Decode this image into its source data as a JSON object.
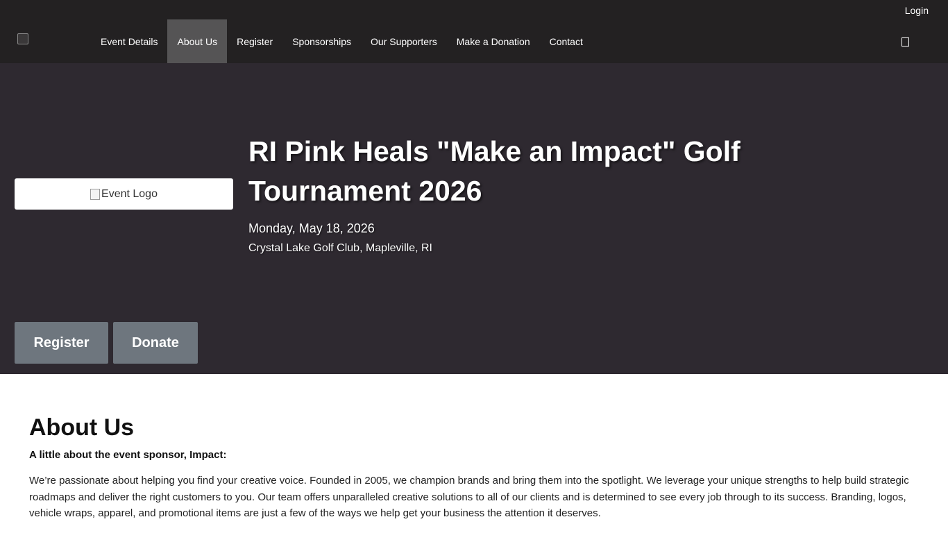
{
  "header": {
    "login_label": "Login",
    "nav": [
      {
        "label": "Event Details"
      },
      {
        "label": "About Us",
        "active": true
      },
      {
        "label": "Register"
      },
      {
        "label": "Sponsorships"
      },
      {
        "label": "Our Supporters"
      },
      {
        "label": "Make a Donation"
      },
      {
        "label": "Contact"
      }
    ],
    "search_icon": "search-icon"
  },
  "hero": {
    "logo_alt": "Event Logo",
    "title": "RI Pink Heals \"Make an Impact\" Golf Tournament 2026",
    "date": "Monday, May 18, 2026",
    "location": "Crystal Lake Golf Club, Mapleville, RI",
    "register_label": "Register",
    "donate_label": "Donate"
  },
  "about": {
    "heading": "About Us",
    "subheading": "A little about the event sponsor, Impact:",
    "body": "We’re passionate about helping you find your creative voice. Founded in 2005, we champion brands and bring them into the spotlight. We leverage your unique strengths to help build strategic roadmaps and deliver the right customers to you. Our team offers unparalleled creative solutions to all of our clients and is determined to see every job through to its success. Branding, logos, vehicle wraps, apparel, and promotional items are just a few of the ways we help get your business the attention it deserves."
  },
  "colors": {
    "header_bg": "#232122",
    "nav_active_bg": "#555455",
    "hero_bg": "#2e2930",
    "button_bg": "#6e767e"
  }
}
